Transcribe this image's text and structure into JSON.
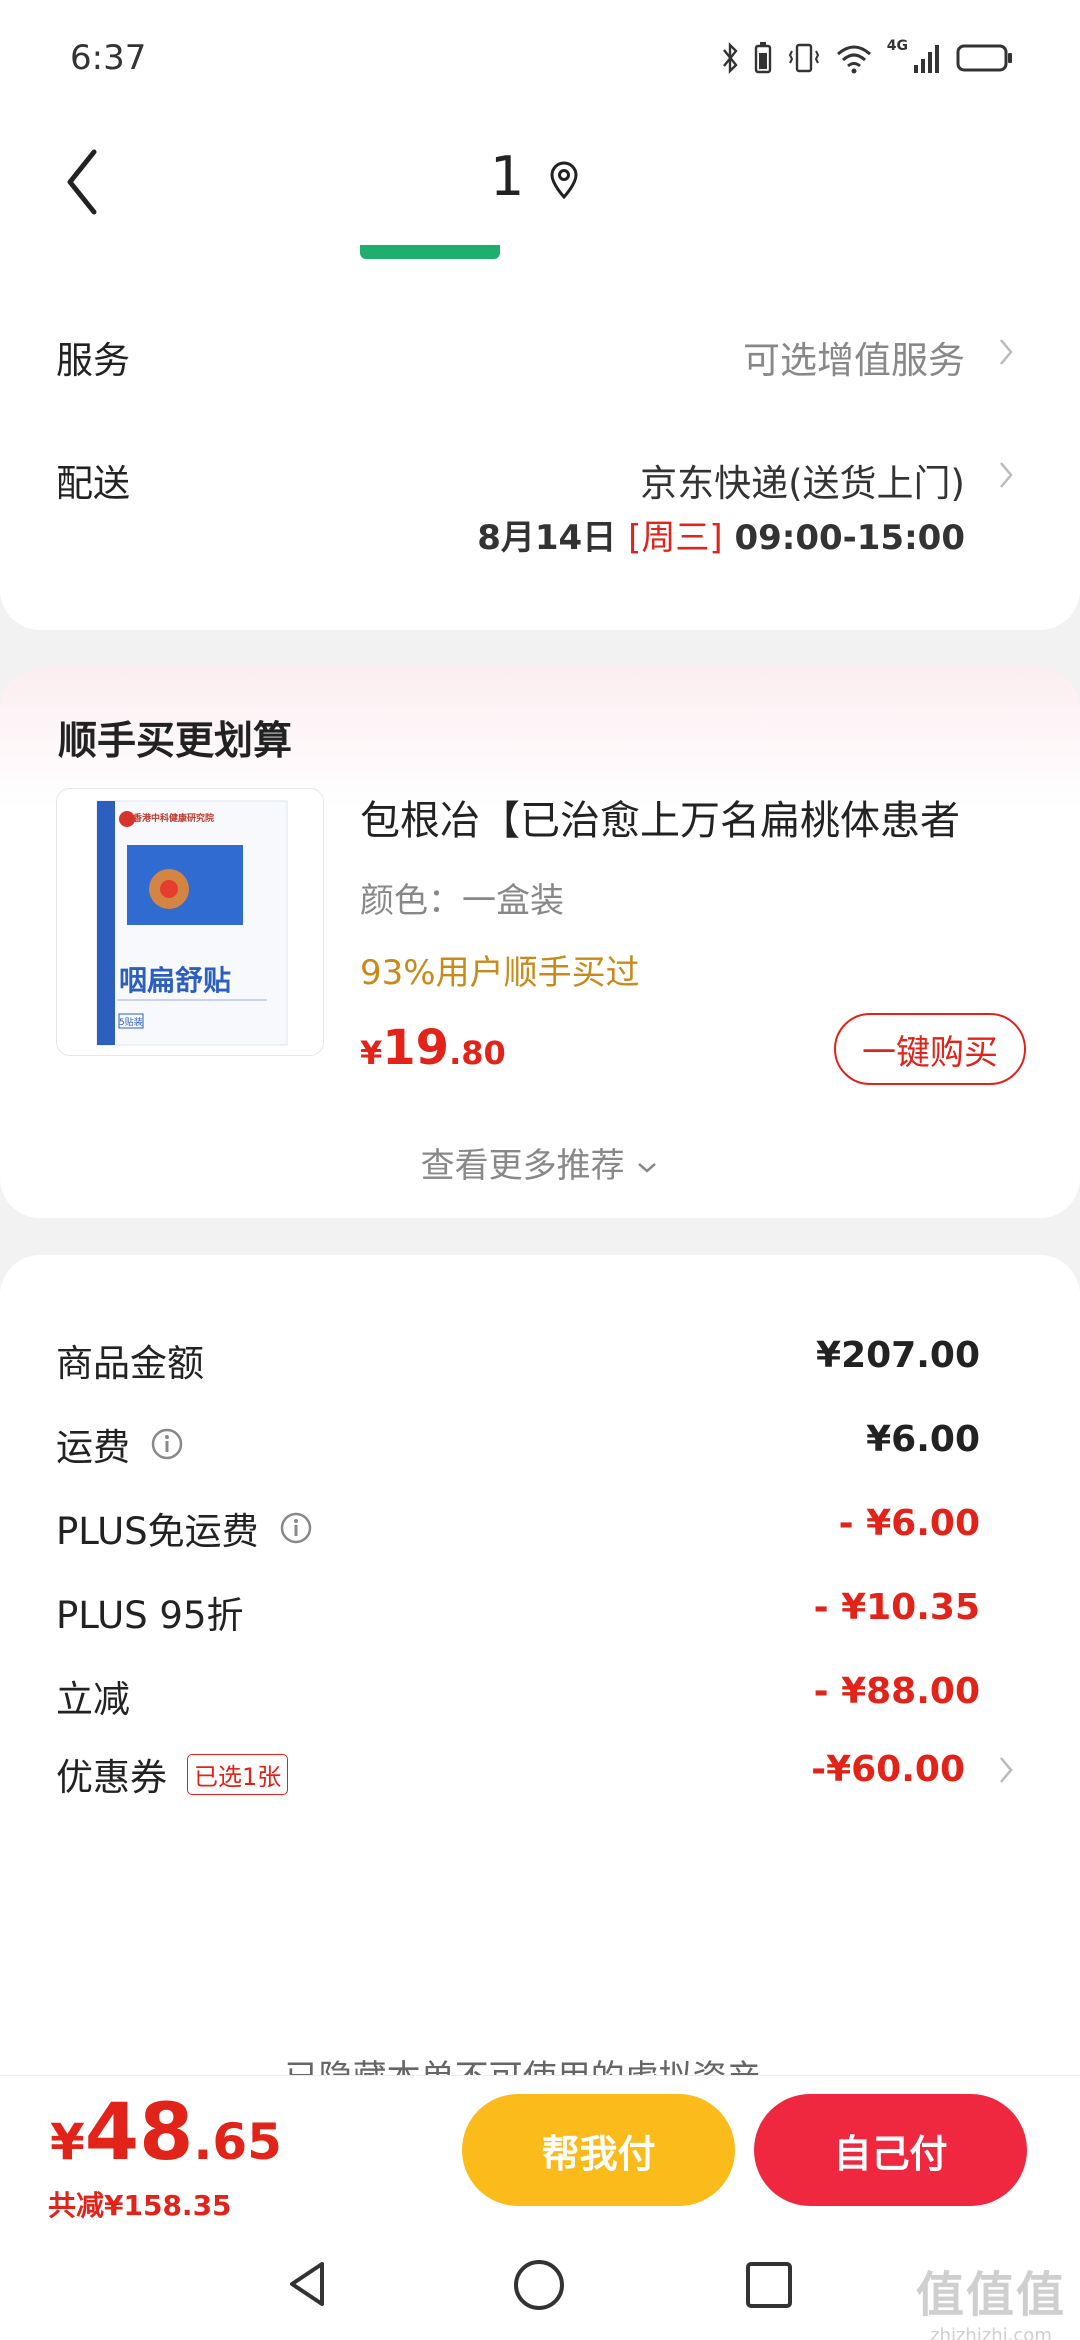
{
  "status_bar": {
    "time": "6:37",
    "network": "4G"
  },
  "nav": {
    "title": "1"
  },
  "service": {
    "label": "服务",
    "value": "可选增值服务"
  },
  "delivery": {
    "label": "配送",
    "method": "京东快递(送货上门)",
    "date": "8月14日",
    "weekday": "[周三]",
    "time_range": "09:00-15:00"
  },
  "recommend": {
    "title": "顺手买更划算",
    "product": {
      "name": "包根冶【已治愈上万名扁桃体患者",
      "color": "颜色：一盒装",
      "bought": "93%用户顺手买过",
      "price_currency": "¥",
      "price_int": "19",
      "price_dec": ".80",
      "buy_label": "一键购买",
      "image_texts": {
        "brand": "香港中科健康研究院",
        "name": "咽扁舒贴",
        "count": "5贴装"
      }
    },
    "more_label": "查看更多推荐"
  },
  "summary": {
    "rows": [
      {
        "label": "商品金额",
        "value": "¥207.00"
      },
      {
        "label": "运费",
        "value": "¥6.00"
      },
      {
        "label": "PLUS免运费",
        "value": "- ¥6.00"
      },
      {
        "label": "PLUS 95折",
        "value": "- ¥10.35"
      },
      {
        "label": "立减",
        "value": "- ¥88.00"
      },
      {
        "label": "优惠券",
        "badge": "已选1张",
        "value": "-¥60.00"
      }
    ],
    "hidden_assets": "已隐藏本单不可使用的虚拟资产"
  },
  "bottom": {
    "currency": "¥",
    "total_int": "48",
    "total_dec": ".65",
    "discount": "共减¥158.35",
    "help_pay": "帮我付",
    "self_pay": "自己付"
  },
  "watermark": {
    "big": "值值值",
    "small": "zhizhizhi.com"
  },
  "colors": {
    "accent_red": "#e2231a",
    "help_pay": "#fbbb1a",
    "self_pay": "#ef2840",
    "bought_text": "#c98a1a",
    "green_tag": "#1fae6e"
  }
}
